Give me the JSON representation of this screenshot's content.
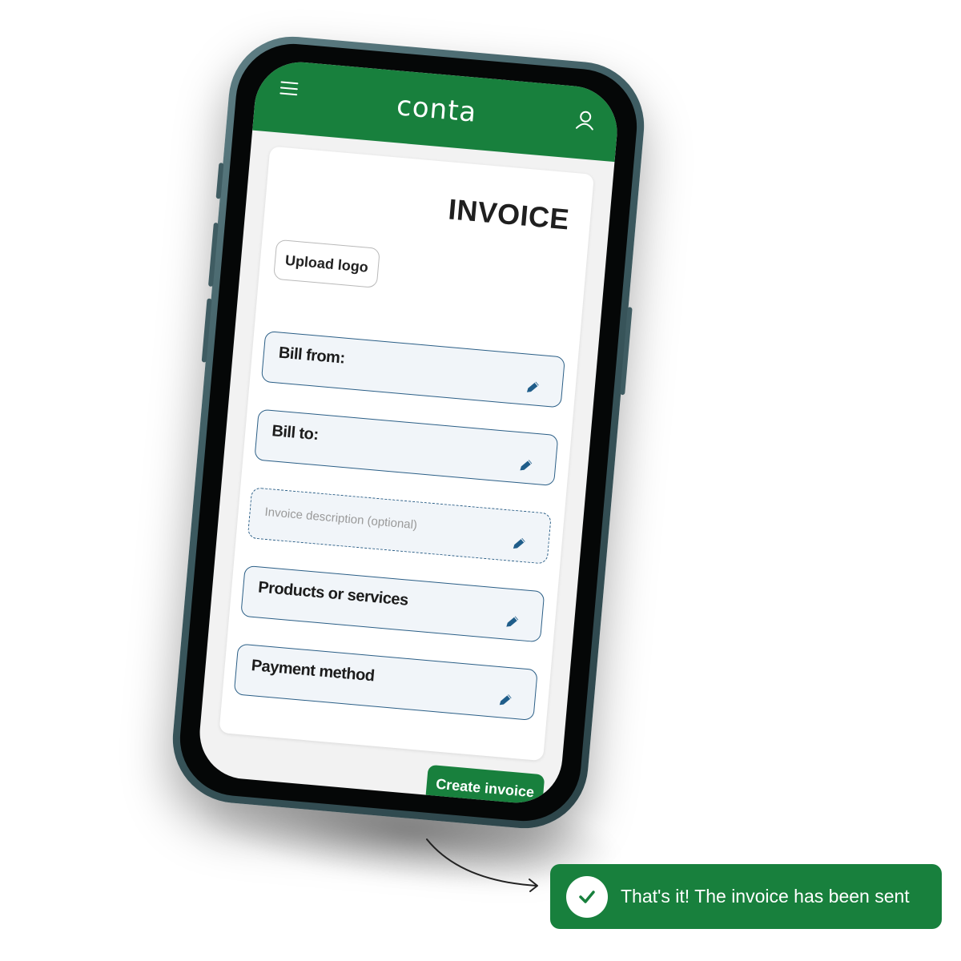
{
  "colors": {
    "brand_green": "#18803d",
    "field_border": "#2a5e86",
    "pencil_blue": "#1f5d8a"
  },
  "header": {
    "logo_text": "conta",
    "menu_icon": "hamburger-menu-icon",
    "account_icon": "user-icon"
  },
  "invoice": {
    "title": "INVOICE",
    "upload_logo_label": "Upload logo",
    "fields": [
      {
        "label": "Bill from:",
        "style": "solid",
        "icon": "pencil-icon"
      },
      {
        "label": "Bill to:",
        "style": "solid",
        "icon": "pencil-icon"
      },
      {
        "placeholder": "Invoice description (optional)",
        "style": "dashed",
        "icon": "pencil-icon"
      },
      {
        "label": "Products or services",
        "style": "solid",
        "icon": "pencil-icon"
      },
      {
        "label": "Payment method",
        "style": "solid",
        "icon": "pencil-icon"
      }
    ],
    "create_button_label": "Create invoice"
  },
  "toast": {
    "icon": "check-circle-icon",
    "message": "That's it! The invoice has been sent"
  }
}
